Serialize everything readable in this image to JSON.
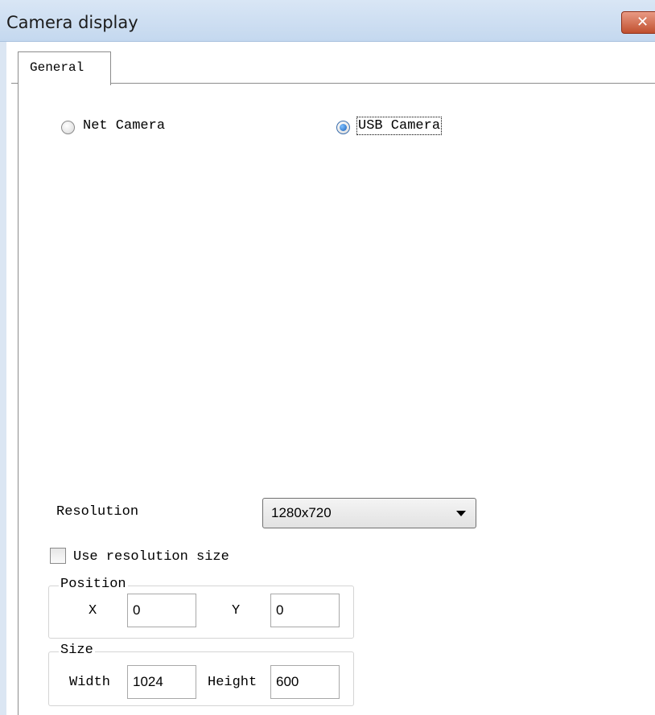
{
  "window": {
    "title": "Camera display"
  },
  "tabs": [
    {
      "label": "General",
      "active": true
    }
  ],
  "camera_type": {
    "options": [
      {
        "label": "Net Camera",
        "selected": false
      },
      {
        "label": "USB Camera",
        "selected": true
      }
    ]
  },
  "resolution": {
    "label": "Resolution",
    "selected": "1280x720"
  },
  "use_resolution_size": {
    "label": "Use resolution size",
    "checked": false
  },
  "position": {
    "title": "Position",
    "x_label": "X",
    "x_value": "0",
    "y_label": "Y",
    "y_value": "0"
  },
  "size": {
    "title": "Size",
    "width_label": "Width",
    "width_value": "1024",
    "height_label": "Height",
    "height_value": "600"
  },
  "colors": {
    "titlebar": "#c4d8ef",
    "close_button": "#c0502f",
    "radio_selected": "#1a5fb8"
  }
}
